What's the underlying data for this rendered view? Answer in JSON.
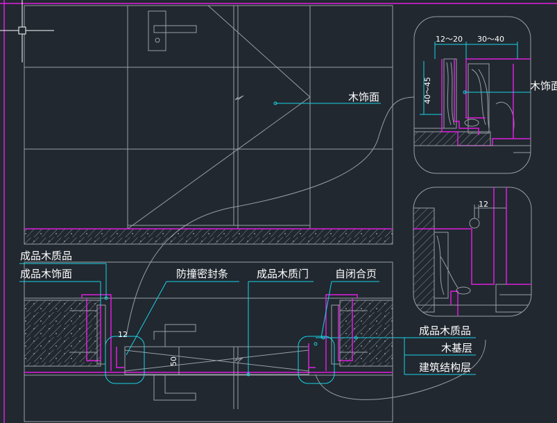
{
  "drawing": {
    "background": "#212830",
    "colors": {
      "linework": "#9aa0a6",
      "leader": "#19d3e6",
      "material": "#e01ee0",
      "text": "#ffffff",
      "crosshair": "#ffffff"
    },
    "elevation": {
      "label_wood_facing": "木饰面"
    },
    "detail_top": {
      "label_wood_facing": "木饰面",
      "dim_left": "12～20",
      "dim_right": "30～40",
      "dim_vertical": "40～45"
    },
    "detail_bottom": {
      "dim_top": "12",
      "label_finished_wood": "成品木质品",
      "label_wood_base": "木基层",
      "label_structure": "建筑结构层"
    },
    "plan": {
      "label_finished_wood": "成品木质品",
      "label_wood_facing": "成品木饰面",
      "label_seal_strip": "防撞密封条",
      "label_finished_door": "成品木质门",
      "label_self_closing_hinge": "自闭合页",
      "dim_12": "12",
      "dim_50": "50"
    }
  }
}
